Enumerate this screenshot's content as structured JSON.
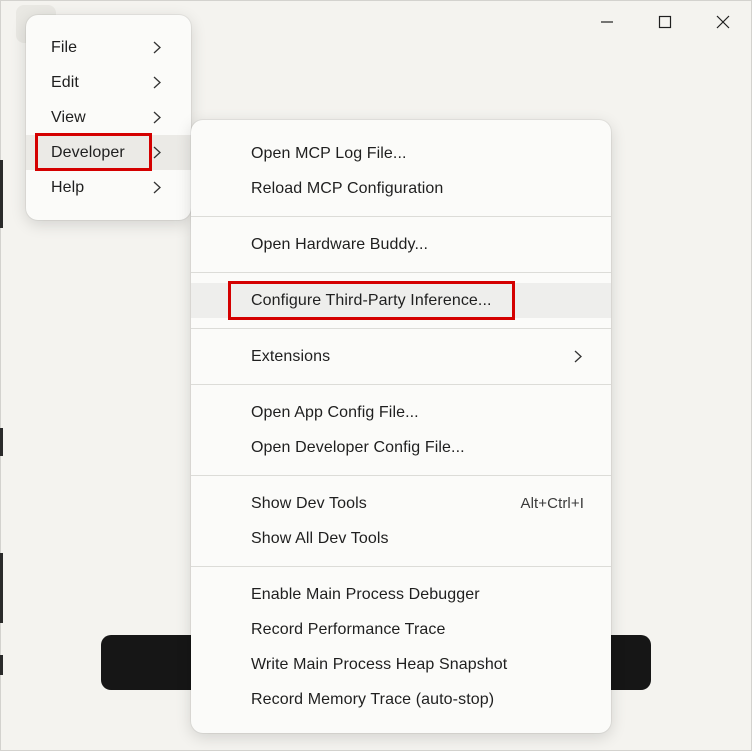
{
  "window": {
    "controls": [
      "minimize-icon",
      "maximize-icon",
      "close-icon"
    ]
  },
  "main_menu": {
    "items": [
      {
        "label": "File",
        "has_submenu": true
      },
      {
        "label": "Edit",
        "has_submenu": true
      },
      {
        "label": "View",
        "has_submenu": true
      },
      {
        "label": "Developer",
        "has_submenu": true,
        "active": true
      },
      {
        "label": "Help",
        "has_submenu": true
      }
    ]
  },
  "developer_menu": {
    "items": [
      {
        "label": "Open MCP Log File..."
      },
      {
        "label": "Reload MCP Configuration"
      },
      {
        "label": "Open Hardware Buddy..."
      },
      {
        "label": "Configure Third-Party Inference...",
        "hovered": true
      },
      {
        "label": "Extensions",
        "has_submenu": true
      },
      {
        "label": "Open App Config File..."
      },
      {
        "label": "Open Developer Config File..."
      },
      {
        "label": "Show Dev Tools",
        "shortcut": "Alt+Ctrl+I"
      },
      {
        "label": "Show All Dev Tools"
      },
      {
        "label": "Enable Main Process Debugger"
      },
      {
        "label": "Record Performance Trace"
      },
      {
        "label": "Write Main Process Heap Snapshot"
      },
      {
        "label": "Record Memory Trace (auto-stop)"
      }
    ]
  },
  "colors": {
    "background": "#f4f3ef",
    "menu_bg": "#fbfbf9",
    "highlight_box": "#d40000",
    "bottom_bar": "#161616"
  }
}
